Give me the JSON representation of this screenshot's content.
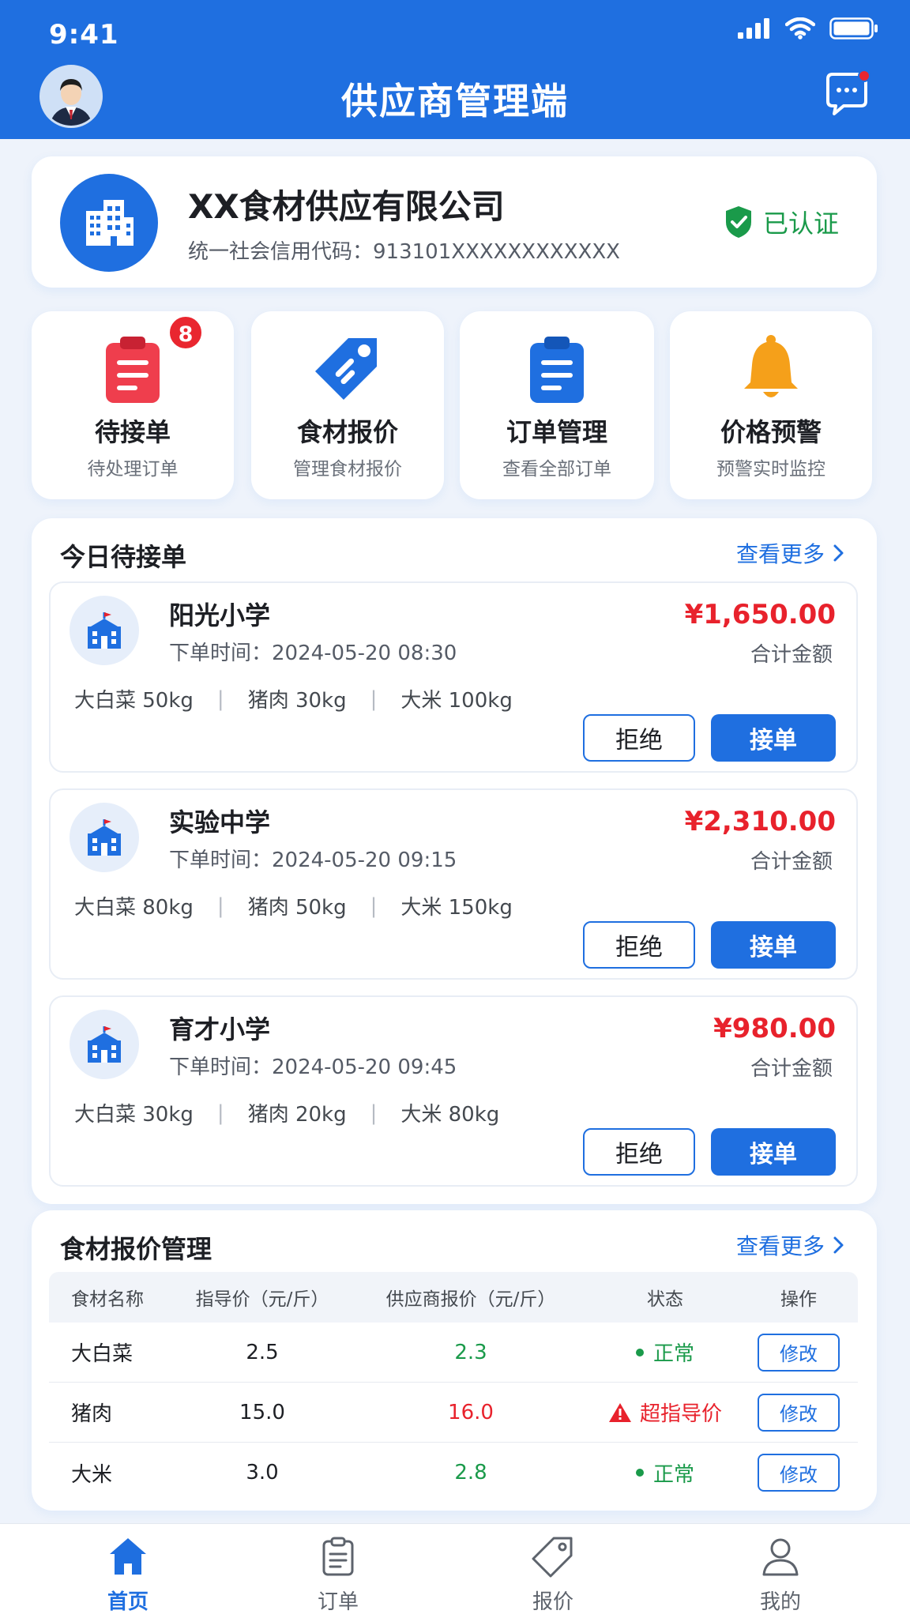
{
  "status_bar": {
    "time": "9:41"
  },
  "header": {
    "title": "供应商管理端"
  },
  "company": {
    "name": "XX食材供应有限公司",
    "credit_code": "统一社会信用代码：913101XXXXXXXXXXXX",
    "verified_label": "已认证"
  },
  "quick_actions": [
    {
      "title": "待接单",
      "subtitle": "待处理订单",
      "badge": "8",
      "icon": "clipboard-icon"
    },
    {
      "title": "食材报价",
      "subtitle": "管理食材报价",
      "icon": "price-tag-icon"
    },
    {
      "title": "订单管理",
      "subtitle": "查看全部订单",
      "icon": "order-clipboard-icon"
    },
    {
      "title": "价格预警",
      "subtitle": "预警实时监控",
      "icon": "bell-icon"
    }
  ],
  "pending_orders": {
    "title": "今日待接单",
    "more_label": "查看更多",
    "reject_label": "拒绝",
    "accept_label": "接单",
    "amount_label": "合计金额",
    "orders": [
      {
        "school": "阳光小学",
        "time": "下单时间：2024-05-20 08:30",
        "amount": "¥1,650.00",
        "items": [
          "大白菜 50kg",
          "猪肉 30kg",
          "大米 100kg"
        ]
      },
      {
        "school": "实验中学",
        "time": "下单时间：2024-05-20 09:15",
        "amount": "¥2,310.00",
        "items": [
          "大白菜 80kg",
          "猪肉 50kg",
          "大米 150kg"
        ]
      },
      {
        "school": "育才小学",
        "time": "下单时间：2024-05-20 09:45",
        "amount": "¥980.00",
        "items": [
          "大白菜 30kg",
          "猪肉 20kg",
          "大米 80kg"
        ]
      }
    ]
  },
  "price_management": {
    "title": "食材报价管理",
    "more_label": "查看更多",
    "columns": [
      "食材名称",
      "指导价（元/斤）",
      "供应商报价（元/斤）",
      "状态",
      "操作"
    ],
    "rows": [
      {
        "name": "大白菜",
        "guide": "2.5",
        "supplier": "2.3",
        "status": "正常",
        "status_type": "normal",
        "action": "修改"
      },
      {
        "name": "猪肉",
        "guide": "15.0",
        "supplier": "16.0",
        "status": "超指导价",
        "status_type": "warning",
        "action": "修改"
      },
      {
        "name": "大米",
        "guide": "3.0",
        "supplier": "2.8",
        "status": "正常",
        "status_type": "normal",
        "action": "修改"
      }
    ]
  },
  "tabbar": [
    {
      "label": "首页",
      "icon": "home-icon",
      "active": true
    },
    {
      "label": "订单",
      "icon": "order-icon",
      "active": false
    },
    {
      "label": "报价",
      "icon": "tag-icon",
      "active": false
    },
    {
      "label": "我的",
      "icon": "user-icon",
      "active": false
    }
  ],
  "colors": {
    "primary": "#1f6fe0",
    "danger": "#e8222c",
    "success": "#1a9a4a",
    "warning": "#f5a01a"
  }
}
